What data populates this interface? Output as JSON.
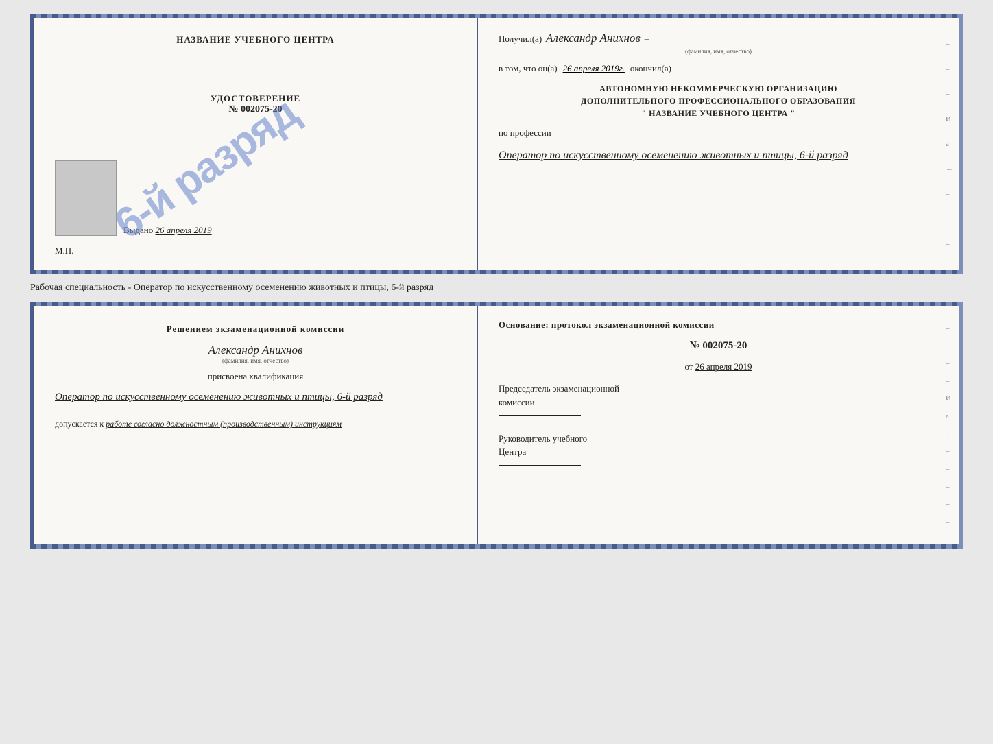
{
  "top_cert": {
    "left": {
      "school_name": "НАЗВАНИЕ УЧЕБНОГО ЦЕНТРА",
      "udostoverenie_label": "УДОСТОВЕРЕНИЕ",
      "number": "№ 002075-20",
      "vydano_label": "Выдано",
      "vydano_date": "26 апреля 2019",
      "mp_label": "М.П.",
      "stamp_text": "6-й разряд"
    },
    "right": {
      "poluchil_label": "Получил(а)",
      "poluchil_name": "Александр Анихнов",
      "fio_small": "(фамилия, имя, отчество)",
      "dash1": "–",
      "vtom_label": "в том, что он(а)",
      "vtom_date": "26 апреля 2019г.",
      "okончil_label": "окончил(а)",
      "org_line1": "АВТОНОМНУЮ НЕКОММЕРЧЕСКУЮ ОРГАНИЗАЦИЮ",
      "org_line2": "ДОПОЛНИТЕЛЬНОГО ПРОФЕССИОНАЛЬНОГО ОБРАЗОВАНИЯ",
      "org_line3": "\"   НАЗВАНИЕ УЧЕБНОГО ЦЕНТРА   \"",
      "dash2": "–",
      "po_professii": "по профессии",
      "profession": "Оператор по искусственному осеменению животных и птицы, 6-й разряд",
      "dashes": [
        "–",
        "–",
        "–",
        "И",
        "а",
        "←",
        "–",
        "–",
        "–"
      ]
    }
  },
  "middle_label": "Рабочая специальность - Оператор по искусственному осеменению животных и птицы, 6-й разряд",
  "bottom_cert": {
    "left": {
      "reshenie": "Решением экзаменационной комиссии",
      "person_name": "Александр Анихнов",
      "fio_small": "(фамилия, имя, отчество)",
      "prisvoena": "присвоена квалификация",
      "qualification": "Оператор по искусственному осеменению животных и птицы, 6-й разряд",
      "dopuskaetsya_label": "допускается к",
      "dopuskaetsya_text": "работе согласно должностным (производственным) инструкциям"
    },
    "right": {
      "osnovanie": "Основание: протокол экзаменационной комиссии",
      "protocol_number": "№ 002075-20",
      "ot_label": "от",
      "ot_date": "26 апреля 2019",
      "predsedatel_line1": "Председатель экзаменационной",
      "predsedatel_line2": "комиссии",
      "rukovoditel_line1": "Руководитель учебного",
      "rukovoditel_line2": "Центра",
      "dashes": [
        "–",
        "–",
        "–",
        "–",
        "И",
        "а",
        "←",
        "–",
        "–",
        "–",
        "–",
        "–"
      ]
    }
  }
}
